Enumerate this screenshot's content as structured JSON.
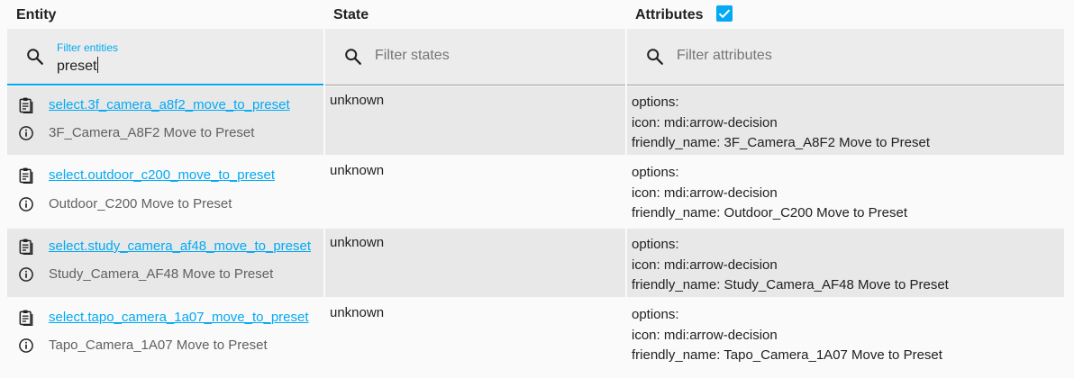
{
  "header": {
    "entity": "Entity",
    "state": "State",
    "attributes": "Attributes",
    "attributes_checked": true
  },
  "filters": {
    "entity_label": "Filter entities",
    "entity_value": "preset",
    "state_placeholder": "Filter states",
    "attributes_placeholder": "Filter attributes"
  },
  "colors": {
    "accent": "#03a9f4",
    "row_alt": "#e8e8e8",
    "background": "#fafafa"
  },
  "rows": [
    {
      "entity_id": "select.3f_camera_a8f2_move_to_preset",
      "friendly": "3F_Camera_A8F2 Move to Preset",
      "state": "unknown",
      "attr_options": "options:",
      "attr_icon": "icon: mdi:arrow-decision",
      "attr_friendly": "friendly_name: 3F_Camera_A8F2 Move to Preset"
    },
    {
      "entity_id": "select.outdoor_c200_move_to_preset",
      "friendly": "Outdoor_C200 Move to Preset",
      "state": "unknown",
      "attr_options": "options:",
      "attr_icon": "icon: mdi:arrow-decision",
      "attr_friendly": "friendly_name: Outdoor_C200 Move to Preset"
    },
    {
      "entity_id": "select.study_camera_af48_move_to_preset",
      "friendly": "Study_Camera_AF48 Move to Preset",
      "state": "unknown",
      "attr_options": "options:",
      "attr_icon": "icon: mdi:arrow-decision",
      "attr_friendly": "friendly_name: Study_Camera_AF48 Move to Preset"
    },
    {
      "entity_id": "select.tapo_camera_1a07_move_to_preset",
      "friendly": "Tapo_Camera_1A07 Move to Preset",
      "state": "unknown",
      "attr_options": "options:",
      "attr_icon": "icon: mdi:arrow-decision",
      "attr_friendly": "friendly_name: Tapo_Camera_1A07 Move to Preset"
    }
  ]
}
